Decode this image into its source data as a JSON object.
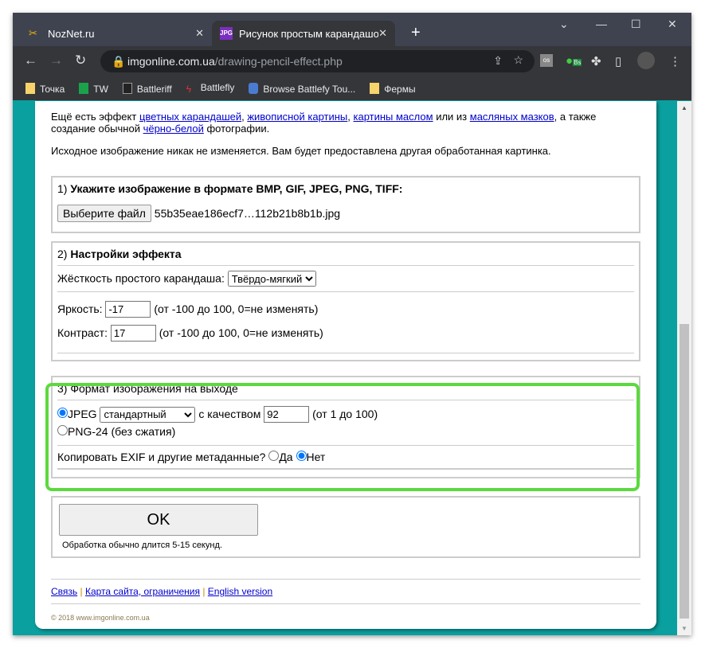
{
  "browser": {
    "tabs": [
      {
        "title": "NozNet.ru"
      },
      {
        "title": "Рисунок простым карандашом"
      }
    ],
    "url_host": "imgonline.com.ua",
    "url_path": "/drawing-pencil-effect.php",
    "bookmarks": [
      "Точка",
      "TW",
      "Battleriff",
      "Battlefly",
      "Browse Battlefy Tou...",
      "Фермы"
    ],
    "extension_badge": "Bs"
  },
  "intro": {
    "t1": "Ещё есть эффект ",
    "l1": "цветных карандашей",
    "s1": ", ",
    "l2": "живописной картины",
    "s2": ", ",
    "l3": "картины маслом",
    "t2": " или из ",
    "l4": "масляных мазков",
    "t3": ", а также создание обычной ",
    "l5": "чёрно-белой",
    "t4": " фотографии.",
    "note": "Исходное изображение никак не изменяется. Вам будет предоставлена другая обработанная картинка."
  },
  "s1": {
    "num": "1) ",
    "title": "Укажите изображение в формате BMP, GIF, JPEG, PNG, TIFF:",
    "button": "Выберите файл",
    "file": "55b35eae186ecf7…112b21b8b1b.jpg"
  },
  "s2": {
    "num": "2) ",
    "title": "Настройки эффекта",
    "hardness_label": "Жёсткость простого карандаша:",
    "hardness_value": "Твёрдо-мягкий",
    "brightness_label": "Яркость:",
    "brightness_value": "-17",
    "brightness_hint": "(от -100 до 100, 0=не изменять)",
    "contrast_label": "Контраст:",
    "contrast_value": "17",
    "contrast_hint": "(от -100 до 100, 0=не изменять)"
  },
  "s3": {
    "title": "3) Формат изображения на выходе",
    "jpeg": "JPEG",
    "jpeg_mode": "стандартный",
    "quality_label": "с качеством",
    "quality": "92",
    "quality_hint": "(от 1 до 100)",
    "png": "PNG-24 (без сжатия)",
    "exif_label": "Копировать EXIF и другие метаданные?",
    "yes": "Да",
    "no": "Нет",
    "highlight_color": "#5cd93f"
  },
  "submit": {
    "label": "OK",
    "hint": "Обработка обычно длится 5-15 секунд."
  },
  "footer": {
    "links": [
      "Связь",
      "Карта сайта, ограничения",
      "English version"
    ],
    "sep": " | ",
    "copyright": "© 2018 www.imgonline.com.ua"
  }
}
